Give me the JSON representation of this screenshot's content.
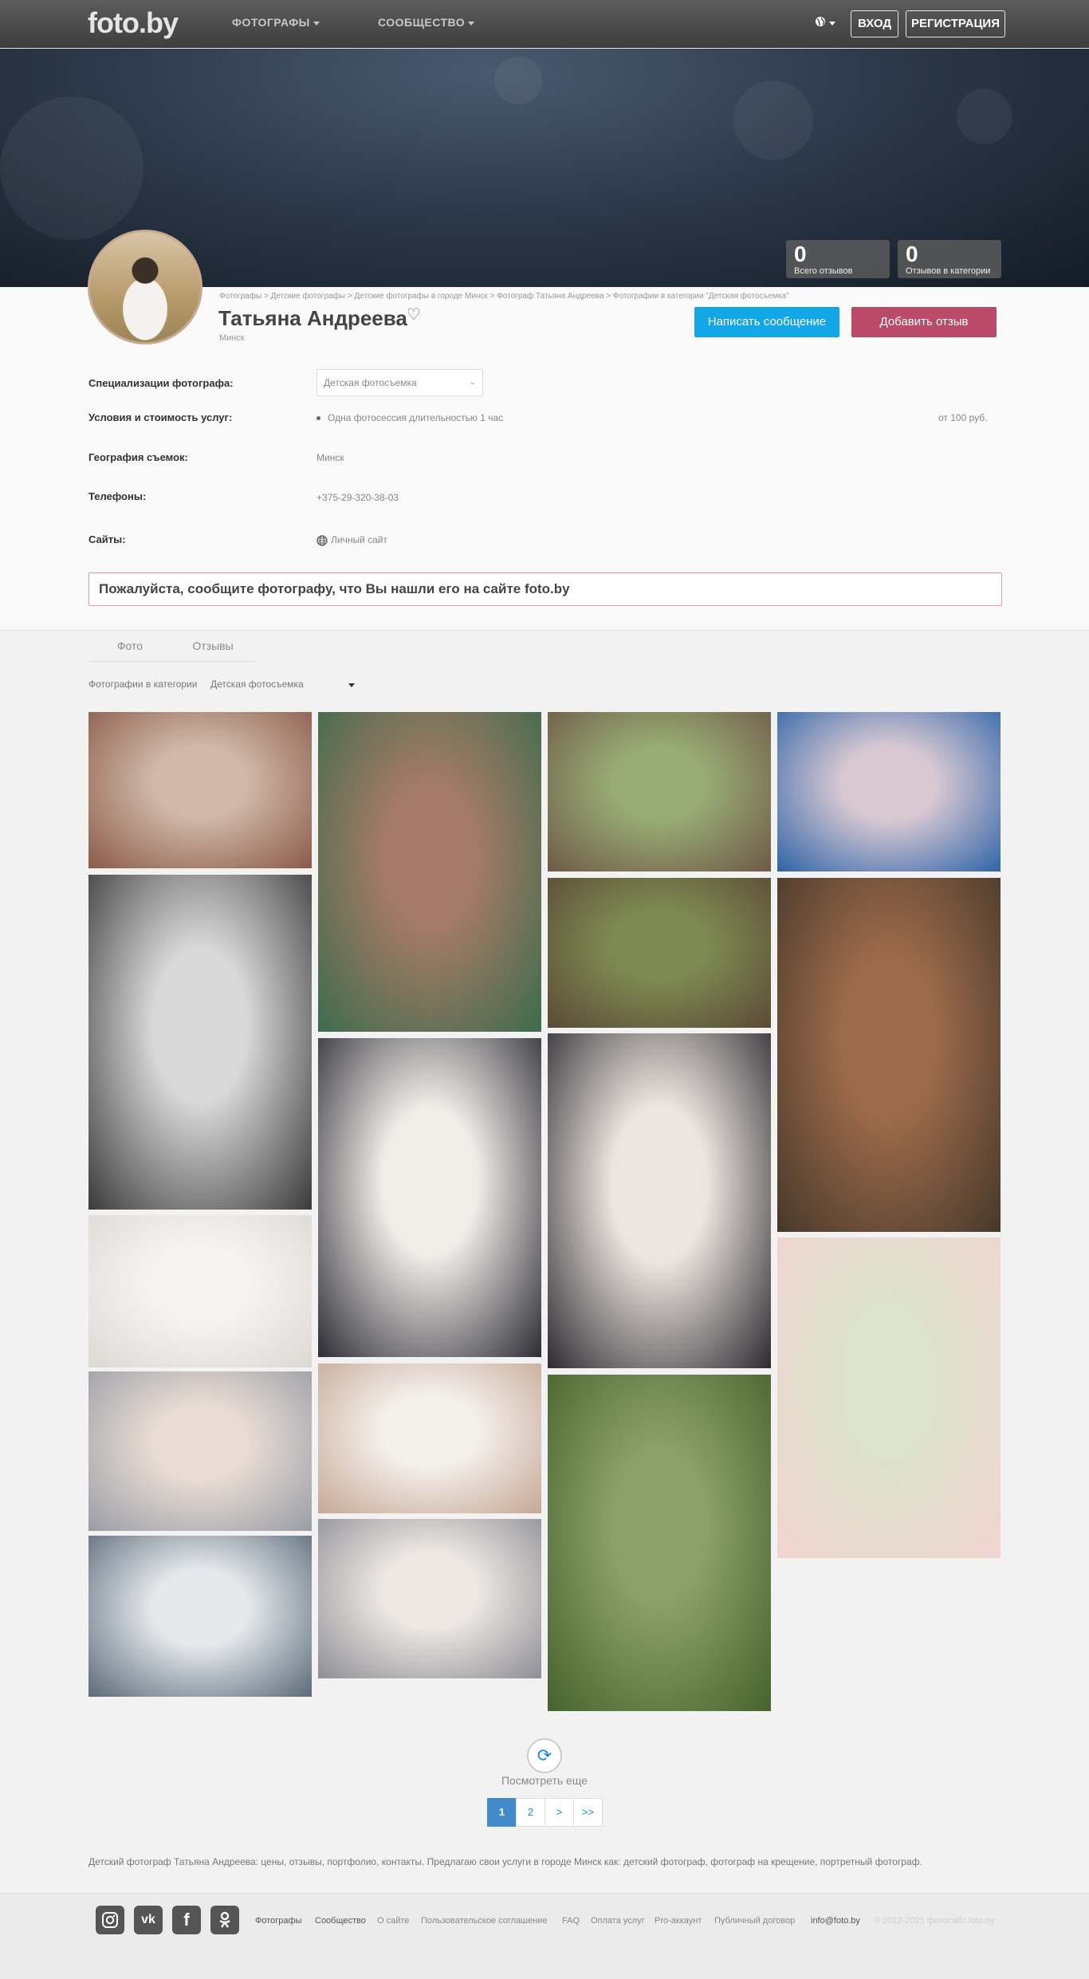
{
  "brand": {
    "logo_text": "foto.by"
  },
  "nav": {
    "photographers": "ФОТОГРАФЫ",
    "community": "СООБЩЕСТВО",
    "language_icon": "globe-icon",
    "login": "ВХОД",
    "register": "РЕГИСТРАЦИЯ"
  },
  "stats": [
    {
      "value": "0",
      "label": "Всего отзывов"
    },
    {
      "value": "0",
      "label": "Отзывов в категории"
    }
  ],
  "breadcrumbs": "Фотографы > Детские фотографы > Детские фотографы в городе Минск > Фотограф Татьяна Андреева > Фотографии в категории \"Детская фотосъемка\"",
  "profile": {
    "name": "Татьяна Андреева",
    "city": "Минск",
    "favorite_icon": "heart-outline-icon",
    "message_button": "Написать сообщение",
    "review_button": "Добавить отзыв"
  },
  "details": {
    "specialization_label": "Специализации фотографа:",
    "specialization_value": "Детская фотосъемка",
    "conditions_label": "Условия и стоимость услуг:",
    "condition_item": "Одна фотосессия длительностью 1 час",
    "condition_price": "от 100 руб.",
    "geography_label": "География съемок:",
    "geography_value": "Минск",
    "phones_label": "Телефоны:",
    "phone_value": "+375-29-320-38-03",
    "sites_label": "Сайты:",
    "site_value": "Личный сайт"
  },
  "notice": "Пожалуйста, сообщите фотографу, что Вы нашли его на сайте foto.by",
  "tabs": [
    "Фото",
    "Отзывы"
  ],
  "category": {
    "label": "Фотографии в категории",
    "value": "Детская фотосъемка"
  },
  "gallery": {
    "photos": [
      {
        "desc": "girl-in-headscarf",
        "colors": [
          "#cfb8a8",
          "#8b5a4a"
        ]
      },
      {
        "desc": "girl-jumping-bw",
        "colors": [
          "#d8d8d8",
          "#3a3a3a"
        ]
      },
      {
        "desc": "baby-on-blanket",
        "colors": [
          "#f6f4f2",
          "#dcd8d4"
        ]
      },
      {
        "desc": "baby-lying-surprised",
        "colors": [
          "#e8dcd4",
          "#9a9da6"
        ]
      },
      {
        "desc": "baby-with-mother-window",
        "colors": [
          "#e6e9ec",
          "#5a6a78"
        ]
      },
      {
        "desc": "girl-portrait-door",
        "colors": [
          "#a37a66",
          "#3d6b4c"
        ]
      },
      {
        "desc": "mother-holding-baby",
        "colors": [
          "#f0ece8",
          "#2c2c34"
        ]
      },
      {
        "desc": "baby-laughing",
        "colors": [
          "#f4f0ec",
          "#c6a896"
        ]
      },
      {
        "desc": "baby-with-toy",
        "colors": [
          "#ede8e4",
          "#8e8e94"
        ]
      },
      {
        "desc": "girl-on-log",
        "colors": [
          "#98ab74",
          "#6e5a48"
        ]
      },
      {
        "desc": "girl-with-dog",
        "colors": [
          "#7e8a52",
          "#5a4a36"
        ]
      },
      {
        "desc": "baby-lifted-by-mother",
        "colors": [
          "#ece6e0",
          "#2d2a30"
        ]
      },
      {
        "desc": "baby-in-grass-bubbles",
        "colors": [
          "#8aa06a",
          "#47622e"
        ]
      },
      {
        "desc": "girl-with-book",
        "colors": [
          "#d7c8d2",
          "#2f64a8"
        ]
      },
      {
        "desc": "girl-with-basket",
        "colors": [
          "#9c6a4a",
          "#46382a"
        ]
      },
      {
        "desc": "mother-lifting-child",
        "colors": [
          "#dce2cc",
          "#f2d4d0"
        ]
      }
    ],
    "load_more": "Посмотреть еще",
    "load_more_icon": "refresh-icon"
  },
  "pagination": [
    "1",
    "2",
    ">",
    ">>"
  ],
  "seo_text": "Детский фотограф Татьяна Андреева: цены, отзывы, портфолио, контакты. Предлагаю свои услуги в городе Минск как: детский фотограф, фотограф на крещение, портретный фотограф.",
  "footer": {
    "social_icons": [
      "instagram-icon",
      "vk-icon",
      "facebook-icon",
      "odnoklassniki-icon"
    ],
    "links": [
      "Фотографы",
      "Сообщество",
      "О сайте",
      "Пользовательское соглашение",
      "FAQ",
      "Оплата услуг",
      "Pro-аккаунт",
      "Публичный договор",
      "info@foto.by"
    ],
    "copyright": "© 2012-2025 фотосайт foto.by"
  }
}
